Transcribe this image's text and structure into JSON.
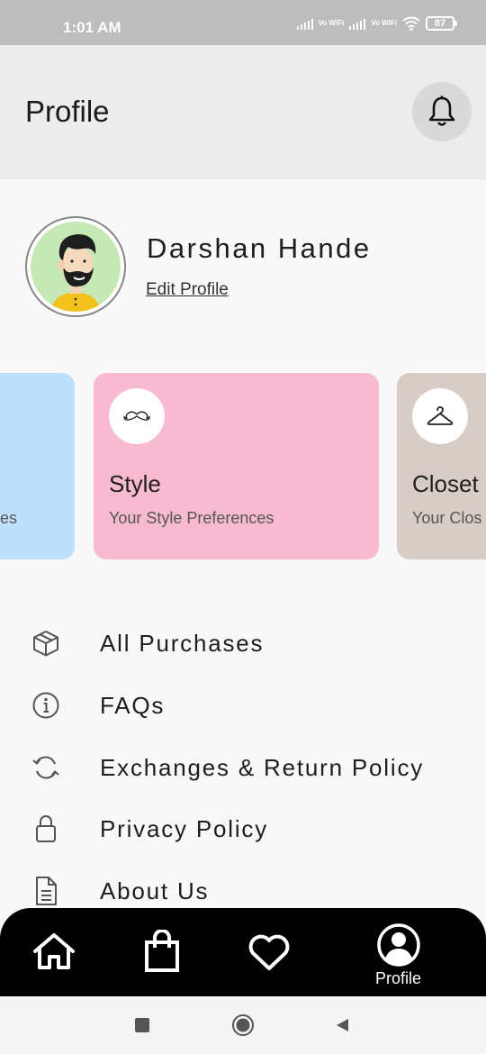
{
  "status_bar": {
    "time": "1:01 AM",
    "network1": "Vo WiFi",
    "network2": "Vo WiFi",
    "battery": "87"
  },
  "header": {
    "title": "Profile",
    "bell_icon": "bell-icon"
  },
  "profile": {
    "name": "Darshan Hande",
    "edit_label": "Edit Profile"
  },
  "cards": [
    {
      "id": "partial-left",
      "title": "",
      "subtitle": "es",
      "color": "#bfe0fb"
    },
    {
      "id": "style",
      "title": "Style",
      "subtitle": "Your Style Preferences",
      "color": "#f7bad0",
      "icon": "mustache-icon"
    },
    {
      "id": "closet",
      "title": "Closet",
      "subtitle": "Your Clos",
      "color": "#d8ccc6",
      "icon": "hanger-icon"
    }
  ],
  "menu": [
    {
      "label": "All Purchases",
      "icon": "box-icon"
    },
    {
      "label": "FAQs",
      "icon": "info-icon"
    },
    {
      "label": "Exchanges & Return Policy",
      "icon": "refresh-icon"
    },
    {
      "label": "Privacy Policy",
      "icon": "lock-icon"
    },
    {
      "label": "About Us",
      "icon": "document-icon"
    }
  ],
  "bottom_nav": {
    "home_icon": "home-icon",
    "bag_icon": "shopping-bag-icon",
    "heart_icon": "heart-icon",
    "profile_label": "Profile"
  },
  "colors": {
    "nav_bg": "#000000",
    "app_bar": "#ececec",
    "status_bar": "#bdbdbd"
  }
}
